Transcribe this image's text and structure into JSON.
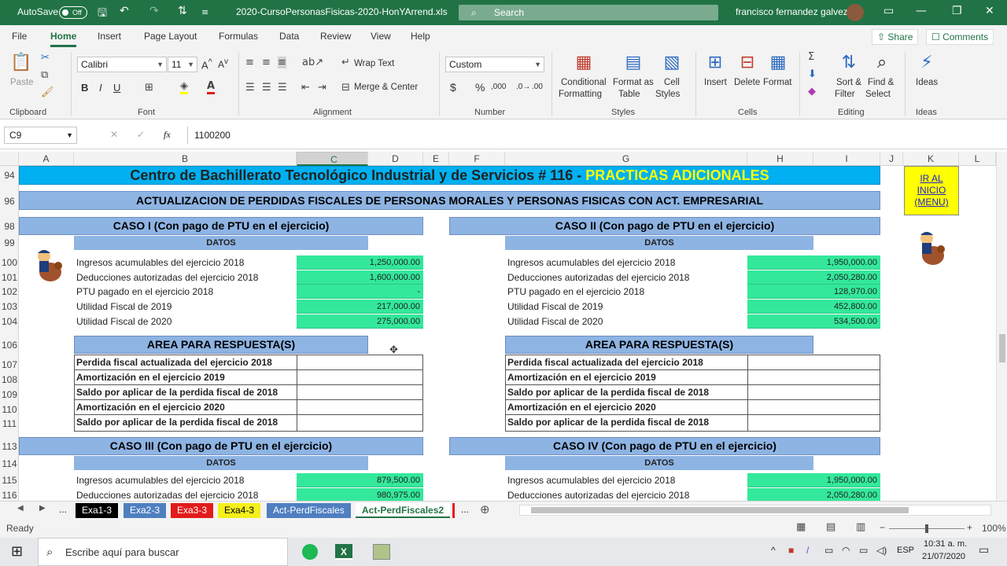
{
  "titlebar": {
    "autosave_label": "AutoSave",
    "autosave_state": "Off",
    "filename": "2020-CursoPersonasFisicas-2020-HonYArrend.xls",
    "search_placeholder": "Search",
    "user_name": "francisco fernandez galvez"
  },
  "menu": {
    "tabs": [
      "File",
      "Home",
      "Insert",
      "Page Layout",
      "Formulas",
      "Data",
      "Review",
      "View",
      "Help"
    ],
    "share_label": "Share",
    "comments_label": "Comments"
  },
  "ribbon": {
    "clipboard": {
      "paste": "Paste",
      "group": "Clipboard"
    },
    "font": {
      "name": "Calibri",
      "size": "11",
      "group": "Font",
      "bold": "B",
      "italic": "I",
      "underline": "U"
    },
    "alignment": {
      "wrap": "Wrap Text",
      "merge": "Merge & Center",
      "group": "Alignment"
    },
    "number": {
      "format": "Custom",
      "currency": "$",
      "percent": "%",
      "group": "Number"
    },
    "styles": {
      "conditional": "Conditional",
      "conditional2": "Formatting",
      "format_as": "Format as",
      "format_as2": "Table",
      "cell": "Cell",
      "cell2": "Styles",
      "group": "Styles"
    },
    "cells": {
      "insert": "Insert",
      "delete": "Delete",
      "format": "Format",
      "group": "Cells"
    },
    "editing": {
      "sort": "Sort &",
      "sort2": "Filter",
      "find": "Find &",
      "find2": "Select",
      "group": "Editing"
    },
    "ideas": {
      "label": "Ideas",
      "group": "Ideas"
    }
  },
  "formula_bar": {
    "name_box": "C9",
    "fx": "fx",
    "value": "1100200"
  },
  "columns": [
    "A",
    "B",
    "C",
    "D",
    "E",
    "F",
    "G",
    "H",
    "I",
    "J",
    "K",
    "L"
  ],
  "rows": [
    "94",
    "96",
    "98",
    "99",
    "100",
    "101",
    "102",
    "103",
    "104",
    "106",
    "107",
    "108",
    "109",
    "110",
    "111",
    "113",
    "114",
    "115",
    "116"
  ],
  "sheet": {
    "banner_title": "Centro de Bachillerato Tecnológico Industrial y de Servicios # 116 - ",
    "banner_highlight": "PRACTICAS ADICIONALES",
    "subtitle": "ACTUALIZACION DE PERDIDAS FISCALES DE PERSONAS MORALES Y PERSONAS FISICAS CON ACT. EMPRESARIAL",
    "menu_link": "IR AL INICIO (MENU)",
    "datos_label": "DATOS",
    "area_label": "AREA PARA RESPUESTA(S)",
    "caso1": {
      "title": "CASO I (Con pago de PTU en el ejercicio)",
      "rows": [
        {
          "label": "Ingresos acumulables del ejercicio 2018",
          "value": "1,250,000.00"
        },
        {
          "label": "Deducciones autorizadas del ejercicio 2018",
          "value": "1,600,000.00"
        },
        {
          "label": "PTU pagado en el ejercicio 2018",
          "value": "-"
        },
        {
          "label": "Utilidad Fiscal de 2019",
          "value": "217,000.00"
        },
        {
          "label": "Utilidad Fiscal de 2020",
          "value": "275,000.00"
        }
      ]
    },
    "caso2": {
      "title": "CASO II (Con pago de PTU en el ejercicio)",
      "rows": [
        {
          "label": "Ingresos acumulables del ejercicio 2018",
          "value": "1,950,000.00"
        },
        {
          "label": "Deducciones autorizadas del ejercicio 2018",
          "value": "2,050,280.00"
        },
        {
          "label": "PTU pagado en el ejercicio 2018",
          "value": "128,970.00"
        },
        {
          "label": "Utilidad Fiscal de 2019",
          "value": "452,800.00"
        },
        {
          "label": "Utilidad Fiscal de 2020",
          "value": "534,500.00"
        }
      ]
    },
    "answers": [
      "Perdida fiscal actualizada del ejercicio 2018",
      "Amortización en el ejercicio 2019",
      "Saldo por aplicar de la perdida fiscal de 2018",
      "Amortización en el ejercicio 2020",
      "Saldo por aplicar de la perdida fiscal de 2018"
    ],
    "caso3": {
      "title": "CASO III (Con pago de PTU en el ejercicio)",
      "rows": [
        {
          "label": "Ingresos acumulables del ejercicio 2018",
          "value": "879,500.00"
        },
        {
          "label": "Deducciones autorizadas del ejercicio 2018",
          "value": "980,975.00"
        }
      ]
    },
    "caso4": {
      "title": "CASO IV (Con pago de PTU en el ejercicio)",
      "rows": [
        {
          "label": "Ingresos acumulables del ejercicio 2018",
          "value": "1,950,000.00"
        },
        {
          "label": "Deducciones autorizadas del ejercicio 2018",
          "value": "2,050,280.00"
        }
      ]
    }
  },
  "sheet_tabs": [
    {
      "label": "Exa1-3",
      "bg": "#000000",
      "fg": "#ffffff"
    },
    {
      "label": "Exa2-3",
      "bg": "#4f7fc1",
      "fg": "#ffffff"
    },
    {
      "label": "Exa3-3",
      "bg": "#e31b1b",
      "fg": "#ffffff"
    },
    {
      "label": "Exa4-3",
      "bg": "#f5ef1a",
      "fg": "#000000"
    },
    {
      "label": "Act-PerdFiscales",
      "bg": "#4f7fc1",
      "fg": "#ffffff"
    },
    {
      "label": "Act-PerdFiscales2",
      "bg": "#ffffff",
      "fg": "#217346"
    }
  ],
  "tab_ellipsis": "...",
  "status": {
    "ready": "Ready",
    "zoom": "100%"
  },
  "taskbar": {
    "search_placeholder": "Escribe aquí para buscar",
    "lang": "ESP",
    "time": "10:31 a. m.",
    "date": "21/07/2020"
  },
  "colors": {
    "excel_green": "#217346",
    "header_blue": "#8eb4e3",
    "banner_cyan": "#00b0f0",
    "value_green": "#33e89b",
    "highlight_yellow": "#ffff00"
  }
}
